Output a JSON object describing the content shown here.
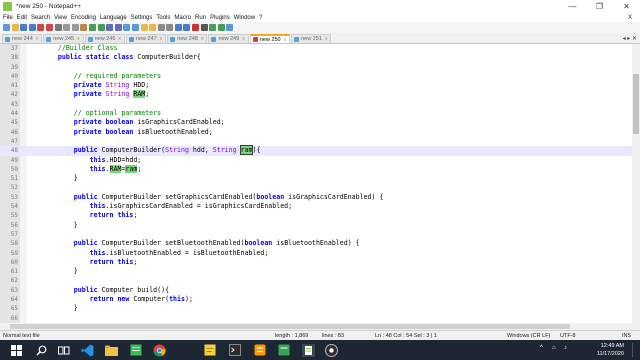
{
  "window": {
    "title": "*new 250 - Notepad++",
    "icon": "notepadpp-icon"
  },
  "window_buttons": [
    "—",
    "❐",
    "✕"
  ],
  "menu": {
    "items": [
      "File",
      "Edit",
      "Search",
      "View",
      "Encoding",
      "Language",
      "Settings",
      "Tools",
      "Macro",
      "Run",
      "Plugins",
      "Window",
      "?"
    ],
    "close": "X"
  },
  "tabs": [
    {
      "label": "new 244",
      "active": false
    },
    {
      "label": "new 245",
      "active": false
    },
    {
      "label": "new 246",
      "active": false
    },
    {
      "label": "new 247",
      "active": false
    },
    {
      "label": "new 248",
      "active": false
    },
    {
      "label": "new 249",
      "active": false
    },
    {
      "label": "new 250",
      "active": true
    },
    {
      "label": "new 251",
      "active": false
    }
  ],
  "tab_close_glyph": "x",
  "tab_scroll_arrows": "◂ ▸ ✕",
  "editor": {
    "current_line": 48,
    "lines": [
      {
        "n": "37",
        "text": "    //Builder Class"
      },
      {
        "n": "38",
        "text": "    public static class ComputerBuilder{"
      },
      {
        "n": "39",
        "text": ""
      },
      {
        "n": "40",
        "text": "        // required parameters"
      },
      {
        "n": "41",
        "text": "        private String HDD;"
      },
      {
        "n": "42",
        "text": "        private String RAM;"
      },
      {
        "n": "43",
        "text": ""
      },
      {
        "n": "44",
        "text": "        // optional parameters"
      },
      {
        "n": "45",
        "text": "        private boolean isGraphicsCardEnabled;"
      },
      {
        "n": "46",
        "text": "        private boolean isBluetoothEnabled;"
      },
      {
        "n": "47",
        "text": ""
      },
      {
        "n": "48",
        "text": "        public ComputerBuilder(String hdd, String ram){"
      },
      {
        "n": "49",
        "text": "            this.HDD=hdd;"
      },
      {
        "n": "50",
        "text": "            this.RAM=ram;"
      },
      {
        "n": "51",
        "text": "        }"
      },
      {
        "n": "52",
        "text": ""
      },
      {
        "n": "53",
        "text": "        public ComputerBuilder setGraphicsCardEnabled(boolean isGraphicsCardEnabled) {"
      },
      {
        "n": "54",
        "text": "            this.isGraphicsCardEnabled = isGraphicsCardEnabled;"
      },
      {
        "n": "55",
        "text": "            return this;"
      },
      {
        "n": "56",
        "text": "        }"
      },
      {
        "n": "57",
        "text": ""
      },
      {
        "n": "58",
        "text": "        public ComputerBuilder setBluetoothEnabled(boolean isBluetoothEnabled) {"
      },
      {
        "n": "59",
        "text": "            this.isBluetoothEnabled = isBluetoothEnabled;"
      },
      {
        "n": "60",
        "text": "            return this;"
      },
      {
        "n": "61",
        "text": "        }"
      },
      {
        "n": "62",
        "text": ""
      },
      {
        "n": "63",
        "text": "        public Computer build(){"
      },
      {
        "n": "64",
        "text": "            return new Computer(this);"
      },
      {
        "n": "65",
        "text": "        }"
      },
      {
        "n": "66",
        "text": ""
      },
      {
        "n": "67",
        "text": "    }"
      }
    ]
  },
  "status": {
    "file_type": "Normal text file",
    "length": "length : 1,869",
    "lines": "lines : 83",
    "position": "Ln : 48    Col : 54    Sel : 3 | 1",
    "eol": "Windows (CR LF)",
    "encoding": "UTF-8",
    "mode": "INS"
  },
  "taskbar": {
    "icons": [
      "windows-start-icon",
      "search-icon",
      "task-view-icon",
      "vscode-icon",
      "file-explorer-icon",
      "chrome-icon",
      "notes-icon",
      "terminal-icon",
      "sublime-icon",
      "notepadpp-icon",
      "obs-icon"
    ],
    "tray": {
      "chevron": "^",
      "network": "⌂",
      "volume": "♪"
    },
    "time": "12:49 AM",
    "date": "11/17/2020"
  },
  "colors": {
    "keyword": "#0000ff",
    "type": "#8000ff",
    "comment": "#008000",
    "highlight": "#7bd67b",
    "current_line": "#e8e8ff",
    "active_tab_accent": "#f6a623"
  }
}
